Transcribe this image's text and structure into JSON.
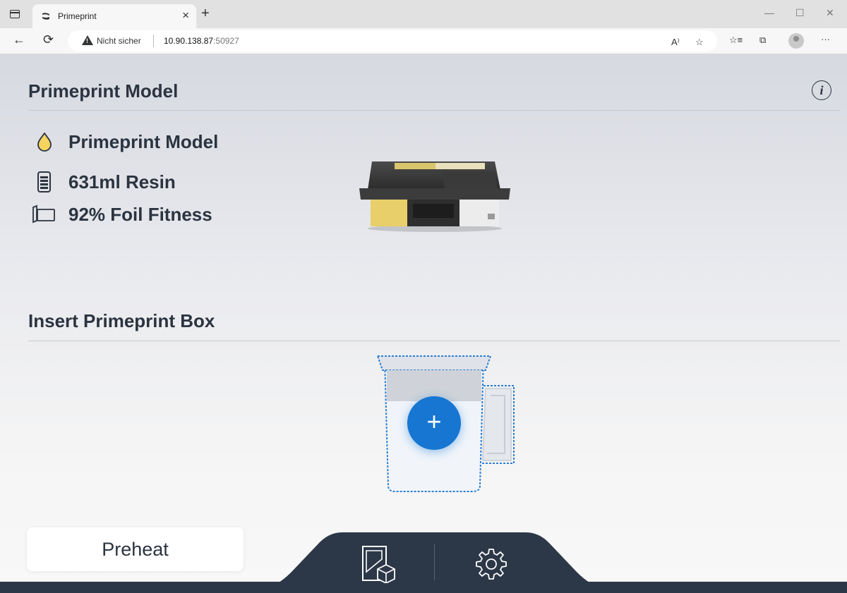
{
  "browser": {
    "tab_title": "Primeprint",
    "tab_close": "×",
    "new_tab": "+",
    "security_label": "Nicht sicher",
    "url_host": "10.90.138.87",
    "url_port": ":50927",
    "more_menu": "···"
  },
  "app": {
    "header_title": "Primeprint Model",
    "material": {
      "name": "Primeprint Model",
      "resin": "631ml Resin",
      "foil": "92% Foil Fitness",
      "drop_color": "#f4d35e"
    },
    "insert_title": "Insert Primeprint Box",
    "add_symbol": "+",
    "preheat_label": "Preheat",
    "info_symbol": "i"
  },
  "colors": {
    "accent": "#1676d2",
    "text_dark": "#2b3440",
    "bar_dark": "#2c3847"
  }
}
